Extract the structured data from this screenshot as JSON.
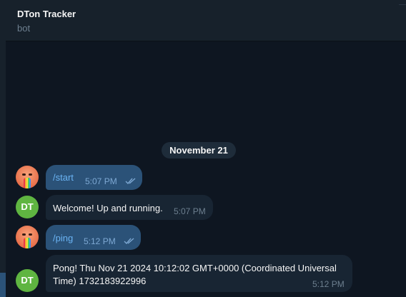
{
  "header": {
    "title": "DTon Tracker",
    "subtitle": "bot"
  },
  "date_separator": "November 21",
  "bot_avatar": {
    "initials": "DT",
    "color": "#5fb541"
  },
  "messages": [
    {
      "direction": "outgoing",
      "text": "/start",
      "time": "5:07 PM",
      "status": "read"
    },
    {
      "direction": "incoming",
      "text": "Welcome! Up and running.",
      "time": "5:07 PM"
    },
    {
      "direction": "outgoing",
      "text": "/ping",
      "time": "5:12 PM",
      "status": "read"
    },
    {
      "direction": "incoming",
      "text_line1": "Pong! Thu Nov 21 2024 10:12:02 GMT+0000 (Coordinated Universal",
      "text_line2": "Time) 1732183922996",
      "time": "5:12 PM"
    }
  ],
  "colors": {
    "background": "#0e1621",
    "header": "#17212b",
    "outgoing_bubble": "#2b5278",
    "incoming_bubble": "#182533",
    "link_text": "#6ab3f3"
  }
}
